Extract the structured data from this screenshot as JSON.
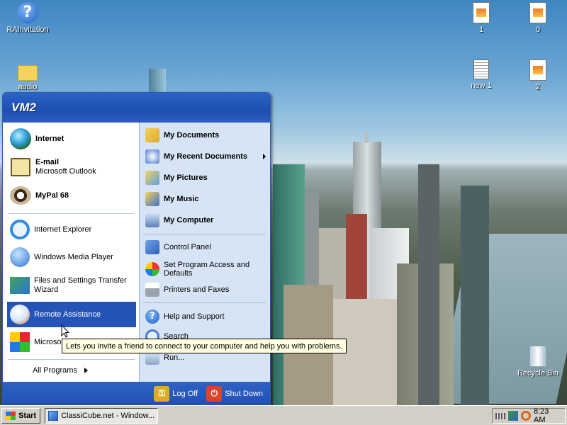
{
  "desktop": {
    "icons": [
      {
        "label": "RAInvitation",
        "icon": "help-icon"
      },
      {
        "label": "audio",
        "icon": "folder-icon"
      },
      {
        "label": "1",
        "icon": "image-file-icon"
      },
      {
        "label": "0",
        "icon": "image-file-icon"
      },
      {
        "label": "new 1",
        "icon": "text-file-icon"
      },
      {
        "label": "2",
        "icon": "image-file-icon"
      },
      {
        "label": "Recycle Bin",
        "icon": "recycle-bin-icon"
      }
    ]
  },
  "start_menu": {
    "user": "VM2",
    "pinned": [
      {
        "label": "Internet",
        "icon": "globe-icon"
      },
      {
        "label": "E-mail",
        "sublabel": "Microsoft Outlook",
        "icon": "outlook-icon"
      },
      {
        "label": "MyPal 68",
        "icon": "mypal-icon"
      }
    ],
    "recent": [
      {
        "label": "Internet Explorer",
        "icon": "internet-explorer-icon"
      },
      {
        "label": "Windows Media Player",
        "icon": "media-player-icon"
      },
      {
        "label": "Files and Settings Transfer Wizard",
        "icon": "transfer-wizard-icon"
      },
      {
        "label": "Remote Assistance",
        "icon": "remote-assistance-icon"
      },
      {
        "label": "Microso",
        "icon": "microsoft-icon"
      }
    ],
    "all_programs": "All Programs",
    "right": [
      {
        "label": "My Documents",
        "icon": "my-documents-icon"
      },
      {
        "label": "My Recent Documents",
        "icon": "recent-documents-icon"
      },
      {
        "label": "My Pictures",
        "icon": "my-pictures-icon"
      },
      {
        "label": "My Music",
        "icon": "my-music-icon"
      },
      {
        "label": "My Computer",
        "icon": "my-computer-icon"
      },
      {
        "label": "Control Panel",
        "icon": "control-panel-icon"
      },
      {
        "label": "Set Program Access and Defaults",
        "icon": "program-access-icon"
      },
      {
        "label": "Printers and Faxes",
        "icon": "printer-icon"
      },
      {
        "label": "Help and Support",
        "icon": "help-icon"
      },
      {
        "label": "Search",
        "icon": "search-icon"
      },
      {
        "label": "Run...",
        "icon": "run-icon"
      }
    ],
    "log_off": "Log Off",
    "shut_down": "Shut Down"
  },
  "tooltip": "Lets you invite a friend to connect to your computer and help you with problems.",
  "taskbar": {
    "start_label": "Start",
    "window_label": "ClassiCube.net - Window...",
    "clock": "8:23 AM"
  }
}
